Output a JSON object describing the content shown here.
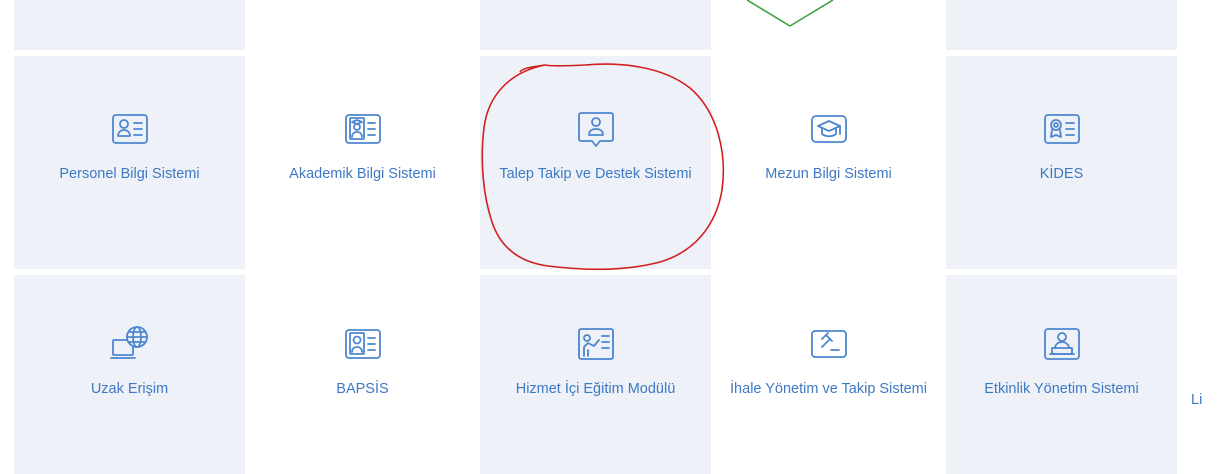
{
  "tiles_row2": [
    {
      "label": "Personel Bilgi Sistemi",
      "icon": "id-card-icon"
    },
    {
      "label": "Akademik Bilgi Sistemi",
      "icon": "academic-id-icon"
    },
    {
      "label": "Talep Takip ve Destek Sistemi",
      "icon": "support-chat-icon"
    },
    {
      "label": "Mezun Bilgi Sistemi",
      "icon": "graduation-cap-icon"
    },
    {
      "label": "KİDES",
      "icon": "certificate-id-icon"
    }
  ],
  "tiles_row3": [
    {
      "label": "Uzak Erişim",
      "icon": "remote-globe-icon"
    },
    {
      "label": "BAPSİS",
      "icon": "id-card-icon"
    },
    {
      "label": "Hizmet İçi Eğitim Modülü",
      "icon": "training-board-icon"
    },
    {
      "label": "İhale Yönetim ve Takip Sistemi",
      "icon": "auction-icon"
    },
    {
      "label": "Etkinlik Yönetim Sistemi",
      "icon": "event-desk-icon"
    },
    {
      "label": "Li"
    }
  ],
  "colors": {
    "tile_background": "#eef1f8",
    "accent_blue": "#3e79c4",
    "annotation_red": "#d22020",
    "annotation_green": "#3aa33a"
  }
}
